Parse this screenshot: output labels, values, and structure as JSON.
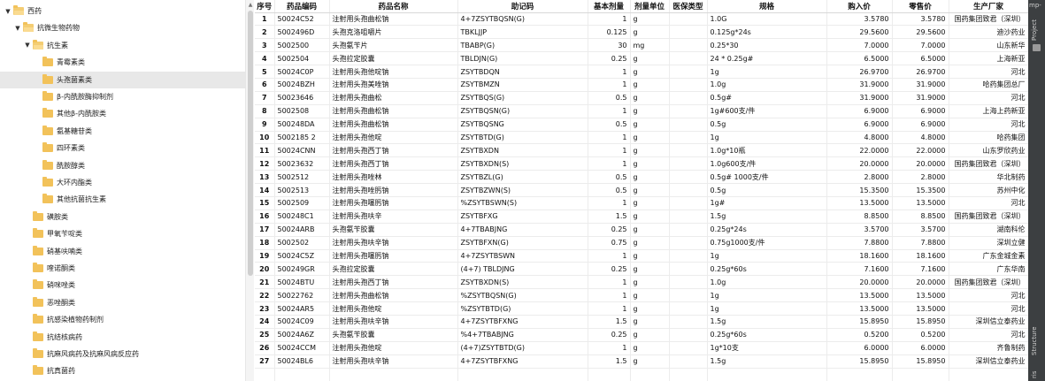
{
  "tree": [
    {
      "label": "西药",
      "depth": 0,
      "expanded": true,
      "selected": false
    },
    {
      "label": "抗微生物药物",
      "depth": 1,
      "expanded": true,
      "selected": false
    },
    {
      "label": "抗生素",
      "depth": 2,
      "expanded": true,
      "selected": false
    },
    {
      "label": "青霉素类",
      "depth": 3,
      "expanded": false,
      "selected": false
    },
    {
      "label": "头孢菌素类",
      "depth": 3,
      "expanded": false,
      "selected": true
    },
    {
      "label": "β-内酰胺酶抑制剂",
      "depth": 3,
      "expanded": false,
      "selected": false
    },
    {
      "label": "其他β-内酰胺类",
      "depth": 3,
      "expanded": false,
      "selected": false
    },
    {
      "label": "氨基糖苷类",
      "depth": 3,
      "expanded": false,
      "selected": false
    },
    {
      "label": "四环素类",
      "depth": 3,
      "expanded": false,
      "selected": false
    },
    {
      "label": "酰胺醇类",
      "depth": 3,
      "expanded": false,
      "selected": false
    },
    {
      "label": "大环内酯类",
      "depth": 3,
      "expanded": false,
      "selected": false
    },
    {
      "label": "其他抗菌抗生素",
      "depth": 3,
      "expanded": false,
      "selected": false
    },
    {
      "label": "磺胺类",
      "depth": 2,
      "expanded": false,
      "selected": false
    },
    {
      "label": "甲氧苄啶类",
      "depth": 2,
      "expanded": false,
      "selected": false
    },
    {
      "label": "硝基呋喃类",
      "depth": 2,
      "expanded": false,
      "selected": false
    },
    {
      "label": "喹诺酮类",
      "depth": 2,
      "expanded": false,
      "selected": false
    },
    {
      "label": "硝咪唑类",
      "depth": 2,
      "expanded": false,
      "selected": false
    },
    {
      "label": "恶唑酮类",
      "depth": 2,
      "expanded": false,
      "selected": false
    },
    {
      "label": "抗感染植物药制剂",
      "depth": 2,
      "expanded": false,
      "selected": false
    },
    {
      "label": "抗结核病药",
      "depth": 2,
      "expanded": false,
      "selected": false
    },
    {
      "label": "抗麻风病药及抗麻风病反应药",
      "depth": 2,
      "expanded": false,
      "selected": false
    },
    {
      "label": "抗真菌药",
      "depth": 2,
      "expanded": false,
      "selected": false
    }
  ],
  "table": {
    "headers": [
      "序号",
      "药品编码",
      "药品名称",
      "助记码",
      "基本剂量",
      "剂量单位",
      "医保类型",
      "规格",
      "购入价",
      "零售价",
      "生产厂家"
    ],
    "rows": [
      [
        "1",
        "50024C52",
        "注射用头孢曲松钠",
        "4+7ZSYTBQSN(G)",
        "1",
        "g",
        "",
        "1.0G",
        "3.5780",
        "3.5780",
        "国药集团致君（深圳）"
      ],
      [
        "2",
        "5002496D",
        "头孢克洛咀嚼片",
        "TBKLJJP",
        "0.125",
        "g",
        "",
        "0.125g*24s",
        "29.5600",
        "29.5600",
        "迪沙药业"
      ],
      [
        "3",
        "5002500",
        "头孢氨苄片",
        "TBABP(G)",
        "30",
        "mg",
        "",
        "0.25*30",
        "7.0000",
        "7.0000",
        "山东新华"
      ],
      [
        "4",
        "5002504",
        "头孢拉定胶囊",
        "TBLDJN(G)",
        "0.25",
        "g",
        "",
        "24 * 0.25g#",
        "6.5000",
        "6.5000",
        "上海新亚"
      ],
      [
        "5",
        "50024C0P",
        "注射用头孢他啶钠",
        "ZSYTBDQN",
        "1",
        "g",
        "",
        "1g",
        "26.9700",
        "26.9700",
        "河北"
      ],
      [
        "6",
        "50024BZH",
        "注射用头孢美唑钠",
        "ZSYTBMZN",
        "1",
        "g",
        "",
        "1.0g",
        "31.9000",
        "31.9000",
        "哈药集团总厂"
      ],
      [
        "7",
        "50023646",
        "注射用头孢曲松",
        "ZSYTBQS(G)",
        "0.5",
        "g",
        "",
        "0.5g#",
        "31.9000",
        "31.9000",
        "河北"
      ],
      [
        "8",
        "5002508",
        "注射用头孢曲松钠",
        "ZSYTBQSN(G)",
        "1",
        "g",
        "",
        "1g#600支/件",
        "6.9000",
        "6.9000",
        "上海上药新亚"
      ],
      [
        "9",
        "500248DA",
        "注射用头孢曲松钠",
        "ZSYTBQSNG",
        "0.5",
        "g",
        "",
        "0.5g",
        "6.9000",
        "6.9000",
        "河北"
      ],
      [
        "10",
        "5002185 2",
        "注射用头孢他啶",
        "ZSYTBTD(G)",
        "1",
        "g",
        "",
        "1g",
        "4.8000",
        "4.8000",
        "哈药集团"
      ],
      [
        "11",
        "50024CNN",
        "注射用头孢西丁钠",
        "ZSYTBXDN",
        "1",
        "g",
        "",
        "1.0g*10瓶",
        "22.0000",
        "22.0000",
        "山东罗欣药业"
      ],
      [
        "12",
        "50023632",
        "注射用头孢西丁钠",
        "ZSYTBXDN(S)",
        "1",
        "g",
        "",
        "1.0g600支/件",
        "20.0000",
        "20.0000",
        "国药集团致君（深圳）"
      ],
      [
        "13",
        "5002512",
        "注射用头孢唑林",
        "ZSYTBZL(G)",
        "0.5",
        "g",
        "",
        "0.5g# 1000支/件",
        "2.8000",
        "2.8000",
        "华北制药"
      ],
      [
        "14",
        "5002513",
        "注射用头孢唑肟钠",
        "ZSYTBZWN(S)",
        "0.5",
        "g",
        "",
        "0.5g",
        "15.3500",
        "15.3500",
        "苏州中化"
      ],
      [
        "15",
        "5002509",
        "注射用头孢噻肟钠",
        "%ZSYTBSWN(S)",
        "1",
        "g",
        "",
        "1g#",
        "13.5000",
        "13.5000",
        "河北"
      ],
      [
        "16",
        "500248C1",
        "注射用头孢呋辛",
        "ZSYTBFXG",
        "1.5",
        "g",
        "",
        "1.5g",
        "8.8500",
        "8.8500",
        "国药集团致君（深圳）"
      ],
      [
        "17",
        "50024ARB",
        "头孢氨苄胶囊",
        "4+7TBABJNG",
        "0.25",
        "g",
        "",
        "0.25g*24s",
        "3.5700",
        "3.5700",
        "湖南科伦"
      ],
      [
        "18",
        "5002502",
        "注射用头孢呋辛钠",
        "ZSYTBFXN(G)",
        "0.75",
        "g",
        "",
        "0.75g1000支/件",
        "7.8800",
        "7.8800",
        "深圳立健"
      ],
      [
        "19",
        "50024C5Z",
        "注射用头孢噻肟钠",
        "4+7ZSYTBSWN",
        "1",
        "g",
        "",
        "1g",
        "18.1600",
        "18.1600",
        "广东金城金素"
      ],
      [
        "20",
        "500249GR",
        "头孢拉定胶囊",
        "(4+7) TBLDJNG",
        "0.25",
        "g",
        "",
        "0.25g*60s",
        "7.1600",
        "7.1600",
        "广东华南"
      ],
      [
        "21",
        "50024BTU",
        "注射用头孢西丁钠",
        "ZSYTBXDN(S)",
        "1",
        "g",
        "",
        "1.0g",
        "20.0000",
        "20.0000",
        "国药集团致君（深圳）"
      ],
      [
        "22",
        "50022762",
        "注射用头孢曲松钠",
        "%ZSYTBQSN(G)",
        "1",
        "g",
        "",
        "1g",
        "13.5000",
        "13.5000",
        "河北"
      ],
      [
        "23",
        "50024AR5",
        "注射用头孢他啶",
        "%ZSYTBTD(G)",
        "1",
        "g",
        "",
        "1g",
        "13.5000",
        "13.5000",
        "河北"
      ],
      [
        "24",
        "50024C09",
        "注射用头孢呋辛钠",
        "4+7ZSYTBFXNG",
        "1.5",
        "g",
        "",
        "1.5g",
        "15.8950",
        "15.8950",
        "深圳信立泰药业"
      ],
      [
        "25",
        "50024A6Z",
        "头孢氨苄胶囊",
        "%4+7TBABJNG",
        "0.25",
        "g",
        "",
        "0.25g*60s",
        "0.5200",
        "0.5200",
        "河北"
      ],
      [
        "26",
        "50024CCM",
        "注射用头孢他啶",
        "(4+7)ZSYTBTD(G)",
        "1",
        "g",
        "",
        "1g*10支",
        "6.0000",
        "6.0000",
        "齐鲁制药"
      ],
      [
        "27",
        "50024BL6",
        "注射用头孢呋辛钠",
        "4+7ZSYTBFXNG",
        "1.5",
        "g",
        "",
        "1.5g",
        "15.8950",
        "15.8950",
        "深圳信立泰药业"
      ]
    ]
  },
  "strip": {
    "top_label": "mp-",
    "project_label": "Project",
    "structure_label": "Structure",
    "ris_label": "ris"
  }
}
